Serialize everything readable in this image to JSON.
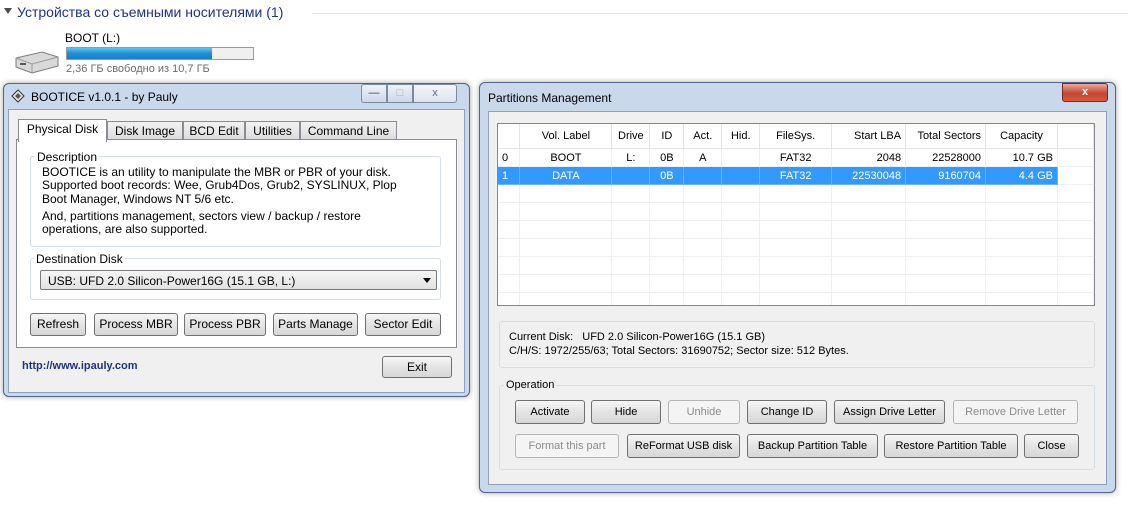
{
  "explorer": {
    "section_title": "Устройства со съемными носителями (1)",
    "drive_name": "BOOT (L:)",
    "drive_free": "2,36 ГБ свободно из 10,7 ГБ",
    "drive_used_fraction": 0.78
  },
  "bootice": {
    "title": "BOOTICE v1.0.1 - by Pauly",
    "tabs": [
      "Physical Disk",
      "Disk Image",
      "BCD Edit",
      "Utilities",
      "Command Line"
    ],
    "description_label": "Description",
    "description_lines": [
      "BOOTICE is an utility to manipulate the MBR or PBR of your disk.",
      "Supported boot records: Wee, Grub4Dos, Grub2, SYSLINUX, Plop",
      "Boot Manager, Windows NT 5/6 etc.",
      "",
      "And, partitions management, sectors view / backup / restore",
      "operations, are also supported."
    ],
    "destination_label": "Destination Disk",
    "destination_value": "USB: UFD 2.0 Silicon-Power16G (15.1 GB, L:)",
    "buttons": {
      "refresh": "Refresh",
      "process_mbr": "Process MBR",
      "process_pbr": "Process PBR",
      "parts_manage": "Parts Manage",
      "sector_edit": "Sector Edit",
      "exit": "Exit"
    },
    "link": "http://www.ipauly.com"
  },
  "partitions": {
    "title": "Partitions Management",
    "columns": [
      "",
      "Vol. Label",
      "Drive",
      "ID",
      "Act.",
      "Hid.",
      "FileSys.",
      "Start LBA",
      "Total Sectors",
      "Capacity"
    ],
    "rows": [
      [
        "0",
        "BOOT",
        "L:",
        "0B",
        "A",
        "",
        "FAT32",
        "2048",
        "22528000",
        "10.7 GB"
      ],
      [
        "1",
        "DATA",
        "",
        "0B",
        "",
        "",
        "FAT32",
        "22530048",
        "9160704",
        "4.4 GB"
      ]
    ],
    "selected_row": 1,
    "current_disk_label": "Current Disk:",
    "current_disk_value": "UFD 2.0 Silicon-Power16G (15.1 GB)",
    "chs_info": "C/H/S: 1972/255/63; Total Sectors: 31690752; Sector size: 512 Bytes.",
    "operation_label": "Operation",
    "buttons": {
      "activate": "Activate",
      "hide": "Hide",
      "unhide": "Unhide",
      "change_id": "Change ID",
      "assign_letter": "Assign Drive Letter",
      "remove_letter": "Remove Drive Letter",
      "format_part": "Format this part",
      "reformat_usb": "ReFormat USB disk",
      "backup_table": "Backup Partition Table",
      "restore_table": "Restore Partition Table",
      "close": "Close"
    }
  },
  "window_controls": {
    "minimize": "—",
    "maximize": "□",
    "close": "x"
  },
  "colors": {
    "accent": "#1e3287",
    "selection": "#3399ff",
    "drive_bar": "#1e8fd6"
  }
}
